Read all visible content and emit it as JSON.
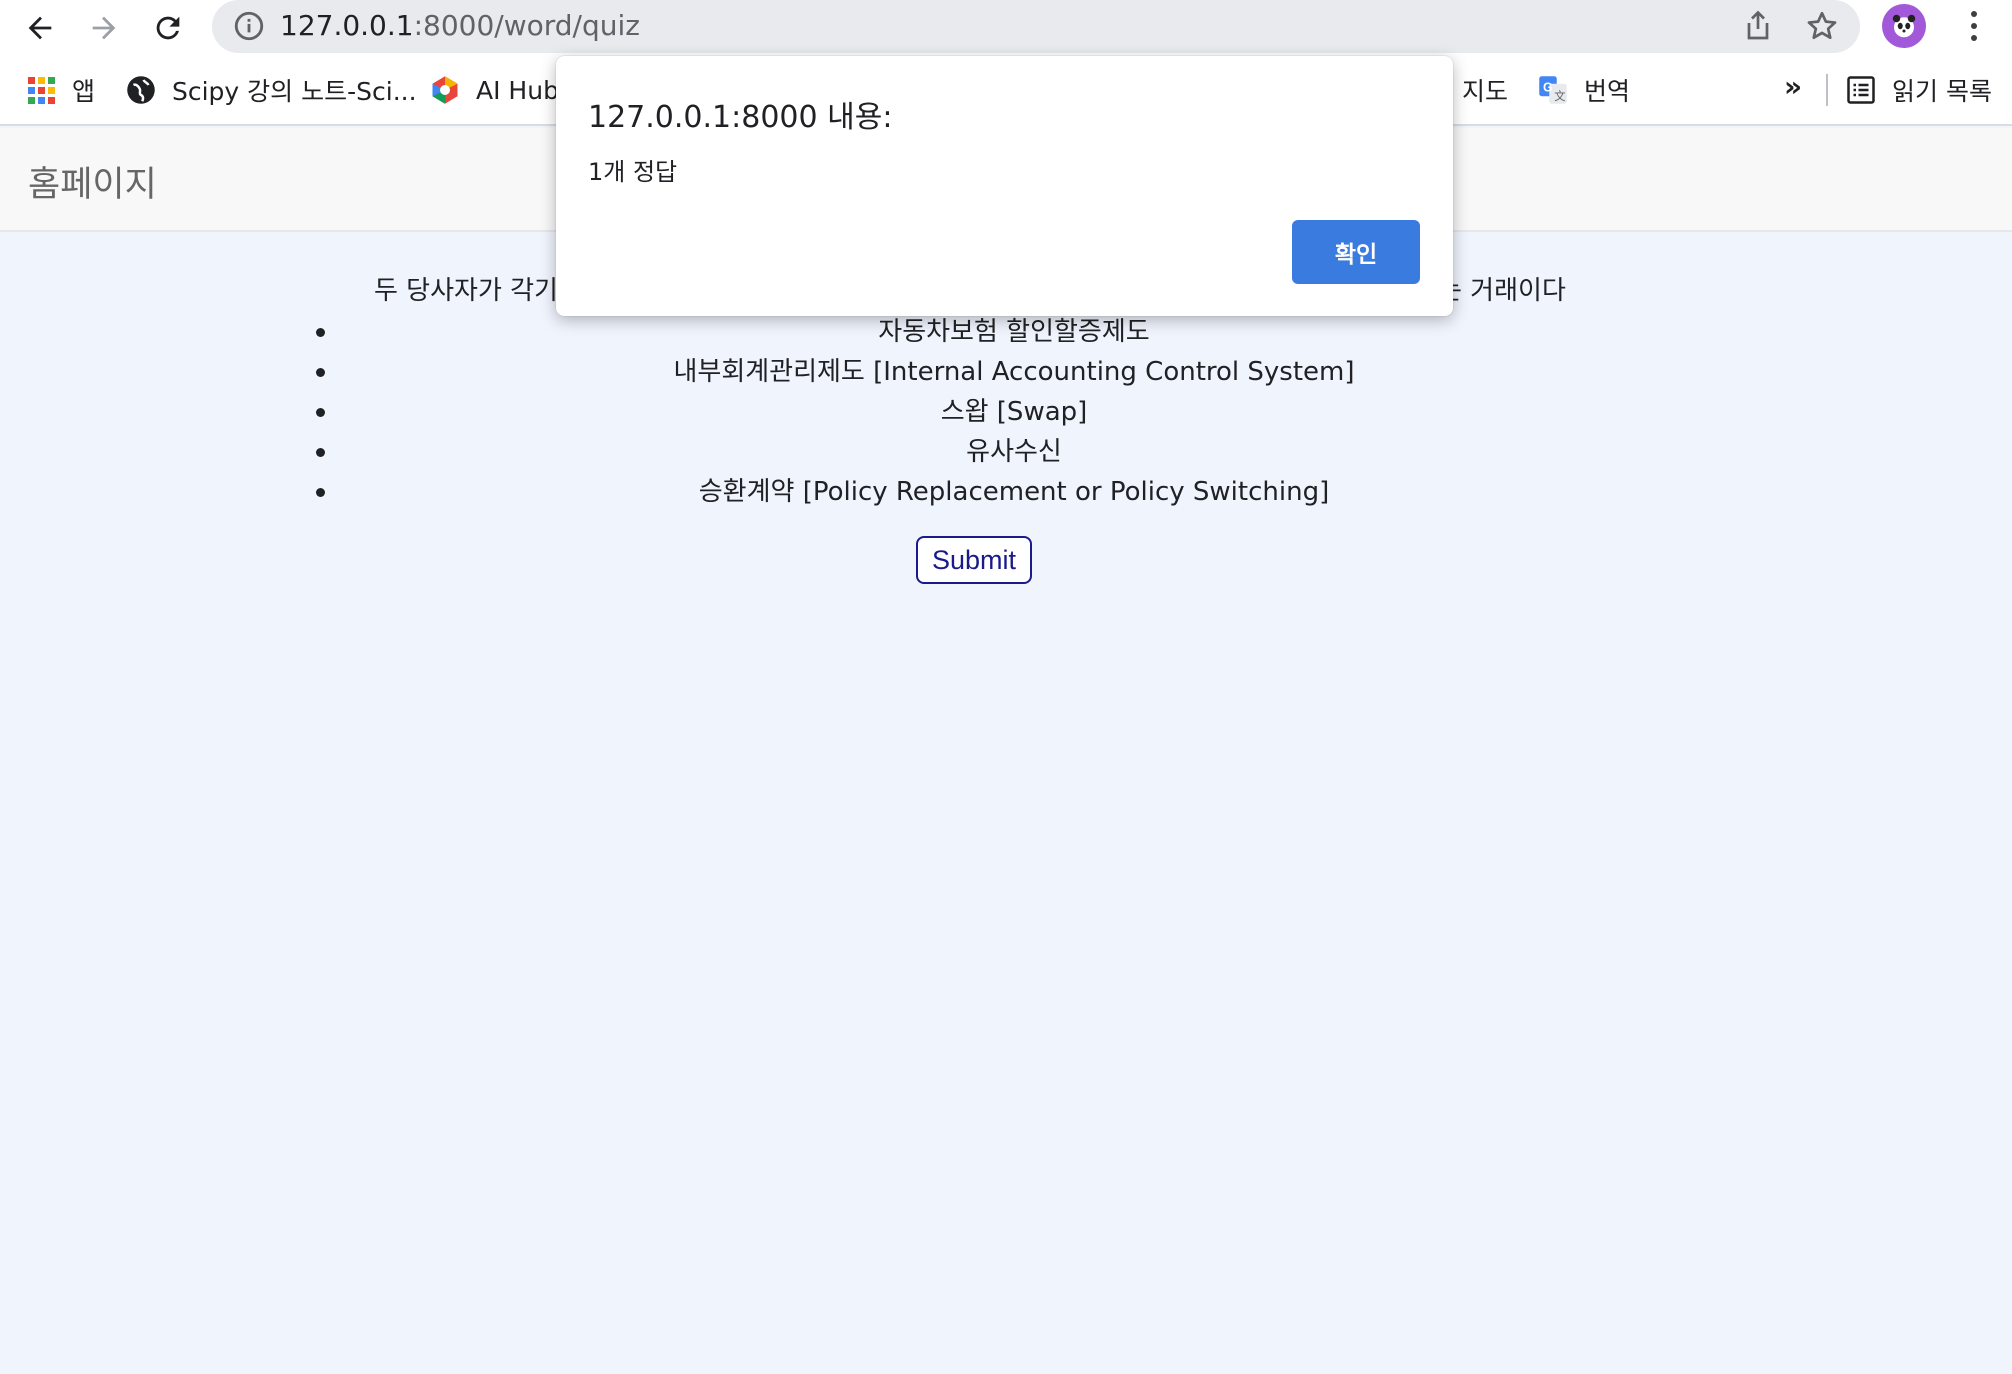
{
  "browser": {
    "url_host": "127.0.0.1",
    "url_path": ":8000/word/quiz",
    "icons": {
      "back": "arrow-left-icon",
      "forward": "arrow-right-icon",
      "reload": "reload-icon",
      "info": "info-icon",
      "share": "share-icon",
      "star": "star-icon",
      "menu": "kebab-menu-icon"
    }
  },
  "bookmarks": {
    "items": [
      {
        "label": "앱",
        "icon": "apps-grid-icon"
      },
      {
        "label": "Scipy 강의 노트-Sci...",
        "icon": "globe-icon"
      },
      {
        "label": "AI Hub",
        "icon": "aihub-icon"
      },
      {
        "label": "지도",
        "icon": "maps-icon"
      },
      {
        "label": "번역",
        "icon": "translate-icon"
      }
    ],
    "more": "»",
    "reading_list": "읽기 목록"
  },
  "page": {
    "brand": "홈페이지",
    "question_start": "두 당사자가 각기",
    "question_end": "는 거래이다",
    "options": [
      "자동차보험 할인할증제도",
      "내부회계관리제도 [Internal Accounting Control System]",
      "스왑 [Swap]",
      "유사수신",
      "승환계약 [Policy Replacement or Policy Switching]"
    ],
    "submit_label": "Submit"
  },
  "dialog": {
    "title": "127.0.0.1:8000 내용:",
    "message": "1개 정답",
    "ok_label": "확인"
  },
  "colors": {
    "page_bg": "#f0f4fd",
    "dialog_button": "#3a7be0",
    "submit_border": "#1a1a8c",
    "avatar_bg": "#a259d9"
  }
}
